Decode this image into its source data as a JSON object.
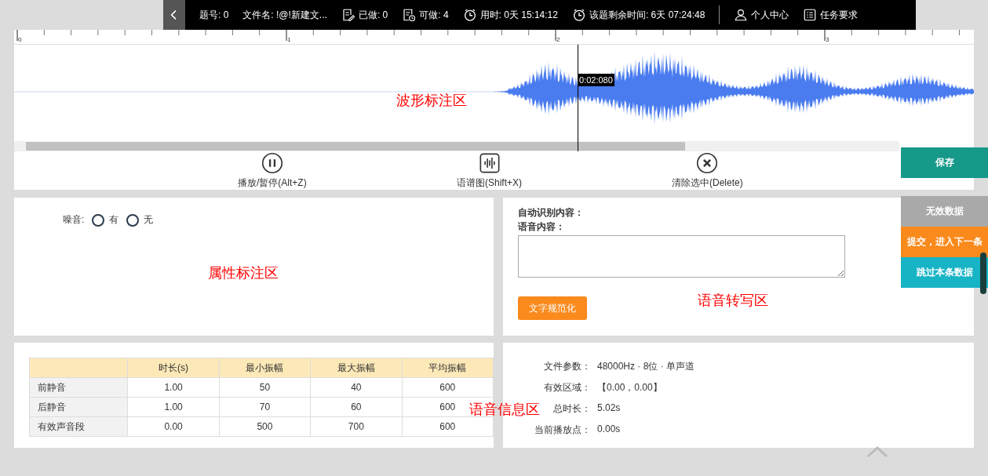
{
  "top_bar": {
    "items": [
      {
        "kind": "plain",
        "text": "题号: 0"
      },
      {
        "kind": "plain",
        "text": "文件名: !@!新建文..."
      },
      {
        "kind": "done",
        "text": "已做: 0"
      },
      {
        "kind": "available",
        "text": "可做: 4"
      },
      {
        "kind": "clock",
        "text": "用时: 0天 15:14:12"
      },
      {
        "kind": "clock",
        "text": "该题剩余时间: 6天 07:24:48"
      },
      {
        "kind": "user",
        "text": "个人中心"
      },
      {
        "kind": "list",
        "text": "任务要求"
      }
    ]
  },
  "waveform": {
    "ruler_labels": [
      "0",
      "1",
      "2",
      "3"
    ],
    "cursor_time": "0:02:080",
    "area_label": "波形标注区",
    "controls": [
      {
        "kind": "pause",
        "label": "播放/暂停(Alt+Z)"
      },
      {
        "kind": "spectrogram",
        "label": "语谱图(Shift+X)"
      },
      {
        "kind": "clear",
        "label": "清除选中(Delete)"
      }
    ]
  },
  "side_buttons": [
    {
      "kind": "save",
      "label": "保存"
    },
    {
      "kind": "invalid",
      "label": "无效数据",
      "disabled": true
    },
    {
      "kind": "submit",
      "label": "提交，进入下一条"
    },
    {
      "kind": "skip",
      "label": "跳过本条数据"
    }
  ],
  "attributes": {
    "noise_label": "噪音:",
    "options": [
      {
        "label": "有",
        "selected": false
      },
      {
        "label": "无",
        "selected": false
      }
    ],
    "area_label": "属性标注区"
  },
  "transcription": {
    "auto_label": "自动识别内容：",
    "content_label": "语音内容：",
    "normalize_button": "文字规范化",
    "area_label": "语音转写区"
  },
  "stats_table": {
    "columns": [
      "时长(s)",
      "最小振幅",
      "最大振幅",
      "平均振幅"
    ],
    "rows": [
      {
        "label": "前静音",
        "values": [
          "1.00",
          "50",
          "40",
          "600"
        ]
      },
      {
        "label": "后静音",
        "values": [
          "1.00",
          "70",
          "60",
          "600"
        ]
      },
      {
        "label": "有效声音段",
        "values": [
          "0.00",
          "500",
          "700",
          "600"
        ]
      }
    ]
  },
  "info": {
    "area_label": "语音信息区",
    "rows": [
      {
        "label": "文件参数：",
        "value": "48000Hz · 8位 · 单声道"
      },
      {
        "label": "有效区域：",
        "value": "【0.00，0.00】"
      },
      {
        "label": "总时长：",
        "value": "5.02s"
      },
      {
        "label": "当前播放点：",
        "value": "0.00s"
      }
    ]
  }
}
